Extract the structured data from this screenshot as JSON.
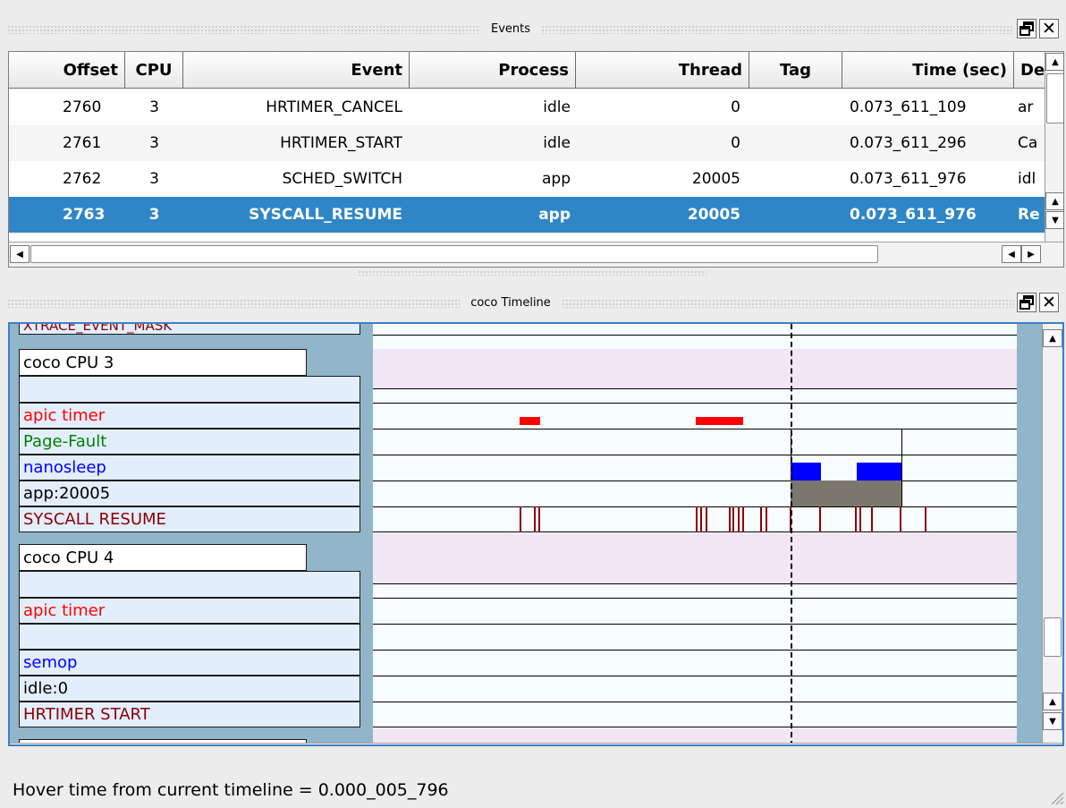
{
  "events_panel": {
    "title": "Events",
    "columns": [
      "Offset",
      "CPU",
      "Event",
      "Process",
      "Thread",
      "Tag",
      "Time (sec)",
      "De"
    ],
    "rows": [
      {
        "offset": "2760",
        "cpu": "3",
        "event": "HRTIMER_CANCEL",
        "process": "idle",
        "thread": "0",
        "tag": "",
        "time": "0.073_611_109",
        "desc": "ar"
      },
      {
        "offset": "2761",
        "cpu": "3",
        "event": "HRTIMER_START",
        "process": "idle",
        "thread": "0",
        "tag": "",
        "time": "0.073_611_296",
        "desc": "Ca"
      },
      {
        "offset": "2762",
        "cpu": "3",
        "event": "SCHED_SWITCH",
        "process": "app",
        "thread": "20005",
        "tag": "",
        "time": "0.073_611_976",
        "desc": "idl"
      },
      {
        "offset": "2763",
        "cpu": "3",
        "event": "SYSCALL_RESUME",
        "process": "app",
        "thread": "20005",
        "tag": "",
        "time": "0.073_611_976",
        "desc": "Re"
      }
    ],
    "selected_row": 3
  },
  "timeline_panel": {
    "title": "coco Timeline",
    "partial_top_label": "XTRACE_EVENT_MASK",
    "cpu3": {
      "header": "coco CPU 3",
      "labels": [
        {
          "text": "",
          "color": "#000000"
        },
        {
          "text": "apic timer",
          "color": "#ff0000"
        },
        {
          "text": "Page-Fault",
          "color": "#008000"
        },
        {
          "text": "nanosleep",
          "color": "#0000ff"
        },
        {
          "text": "app:20005",
          "color": "#000000"
        },
        {
          "text": "SYSCALL RESUME",
          "color": "#8b0000"
        }
      ]
    },
    "cpu4": {
      "header": "coco CPU 4",
      "labels": [
        {
          "text": "",
          "color": "#000000"
        },
        {
          "text": "apic timer",
          "color": "#ff0000"
        },
        {
          "text": "",
          "color": "#000000"
        },
        {
          "text": "semop",
          "color": "#0000ff"
        },
        {
          "text": "idle:0",
          "color": "#000000"
        },
        {
          "text": "HRTIMER START",
          "color": "#8b0000"
        }
      ]
    }
  },
  "status": {
    "hover_text": "Hover time from current timeline = 0.000_005_796"
  },
  "icons": {
    "restore": "restore-window-icon",
    "close": "close-icon",
    "scroll_up": "arrow-up-icon",
    "scroll_down": "arrow-down-icon",
    "scroll_left": "arrow-left-icon",
    "scroll_right": "arrow-right-icon"
  }
}
